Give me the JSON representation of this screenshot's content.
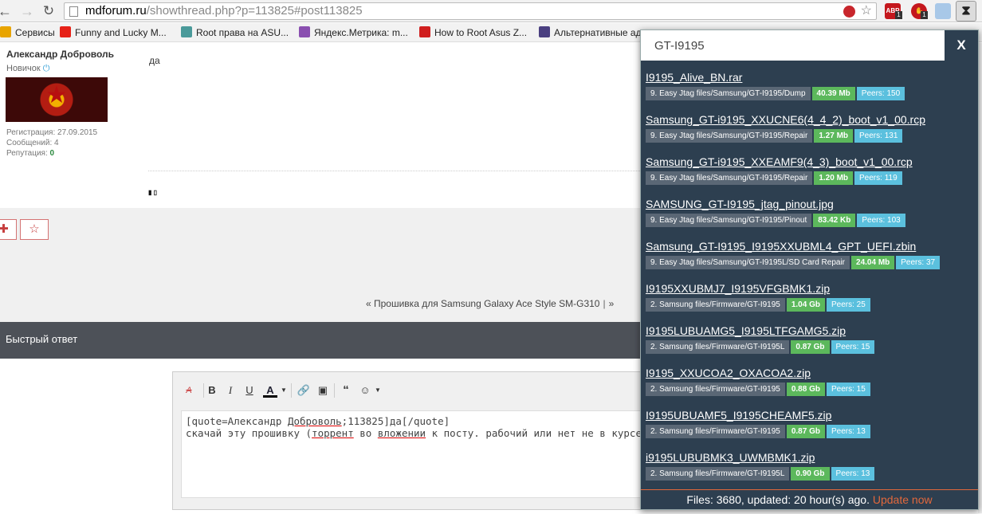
{
  "browser": {
    "url_host": "mdforum.ru",
    "url_path": "/showthread.php?p=113825#post113825",
    "ext_abp_label": "ABP",
    "ext_abp_badge": "1",
    "ext_hand_badge": "1"
  },
  "bookmarks": [
    {
      "label": "Сервисы",
      "icon": "apps-icon",
      "color": "#e8a400"
    },
    {
      "label": "Funny and Lucky M...",
      "icon": "youtube-icon",
      "color": "#e62117"
    },
    {
      "label": "Root права на ASU...",
      "icon": "g-icon",
      "color": "#4a9a9a"
    },
    {
      "label": "Яндекс.Метрика: m...",
      "icon": "metrika-icon",
      "color": "#8a4fb0"
    },
    {
      "label": "How to Root Asus Z...",
      "icon": "slash-icon",
      "color": "#d01f1f"
    },
    {
      "label": "Альтернативные ад",
      "icon": "diamond-icon",
      "color": "#4a3f80"
    }
  ],
  "post": {
    "author": "Александр Доброволь",
    "rank": "Новичок",
    "registration": "Регистрация:  27.09.2015",
    "messages": "Сообщений:  4",
    "reputation_label": "Репутация:",
    "reputation_value": "0",
    "text": "да",
    "small_icons": "▮ ▯"
  },
  "thread_nav": {
    "prev_label": "« Прошивка для Samsung Galaxy Ace Style SM-G310",
    "separator": "|",
    "next_label": "»"
  },
  "quick_reply": {
    "title": "Быстрый ответ"
  },
  "editor": {
    "line1_a": "[quote=Александр ",
    "line1_b": "Доброволь",
    "line1_c": ";113825]да[/quote]",
    "line2_a": "скачай эту прошивку (",
    "line2_b": "торрент",
    "line2_c": " во ",
    "line2_d": "вложении",
    "line2_e": " к посту. рабочий или нет не в курсе, я его выд"
  },
  "popup": {
    "search_value": "GT-I9195",
    "close_label": "X",
    "results": [
      {
        "title": "I9195_Alive_BN.rar",
        "path": "9. Easy Jtag files/Samsung/GT-I9195/Dump",
        "size": "40.39 Mb",
        "peers": "Peers: 150"
      },
      {
        "title": "Samsung_GT-i9195_XXUCNE6(4_4_2)_boot_v1_00.rcp",
        "path": "9. Easy Jtag files/Samsung/GT-I9195/Repair",
        "size": "1.27 Mb",
        "peers": "Peers: 131"
      },
      {
        "title": "Samsung_GT-i9195_XXEAMF9(4_3)_boot_v1_00.rcp",
        "path": "9. Easy Jtag files/Samsung/GT-I9195/Repair",
        "size": "1.20 Mb",
        "peers": "Peers: 119"
      },
      {
        "title": "SAMSUNG_GT-I9195_jtag_pinout.jpg",
        "path": "9. Easy Jtag files/Samsung/GT-I9195/Pinout",
        "size": "83.42 Kb",
        "peers": "Peers: 103"
      },
      {
        "title": "Samsung_GT-I9195_I9195XXUBML4_GPT_UEFI.zbin",
        "path": "9. Easy Jtag files/Samsung/GT-I9195L/SD Card Repair",
        "size": "24.04 Mb",
        "peers": "Peers: 37"
      },
      {
        "title": "I9195XXUBMJ7_I9195VFGBMK1.zip",
        "path": "2. Samsung files/Firmware/GT-I9195",
        "size": "1.04 Gb",
        "peers": "Peers: 25"
      },
      {
        "title": "I9195LUBUAMG5_I9195LTFGAMG5.zip",
        "path": "2. Samsung files/Firmware/GT-I9195L",
        "size": "0.87 Gb",
        "peers": "Peers: 15"
      },
      {
        "title": "I9195_XXUCOA2_OXACOA2.zip",
        "path": "2. Samsung files/Firmware/GT-I9195",
        "size": "0.88 Gb",
        "peers": "Peers: 15"
      },
      {
        "title": "I9195UBUAMF5_I9195CHEAMF5.zip",
        "path": "2. Samsung files/Firmware/GT-I9195",
        "size": "0.87 Gb",
        "peers": "Peers: 13"
      },
      {
        "title": "i9195LUBUBMK3_UWMBMK1.zip",
        "path": "2. Samsung files/Firmware/GT-I9195L",
        "size": "0.90 Gb",
        "peers": "Peers: 13"
      }
    ],
    "footer_text": "Files: 3680, updated: 20 hour(s) ago.",
    "update_label": "Update now"
  }
}
